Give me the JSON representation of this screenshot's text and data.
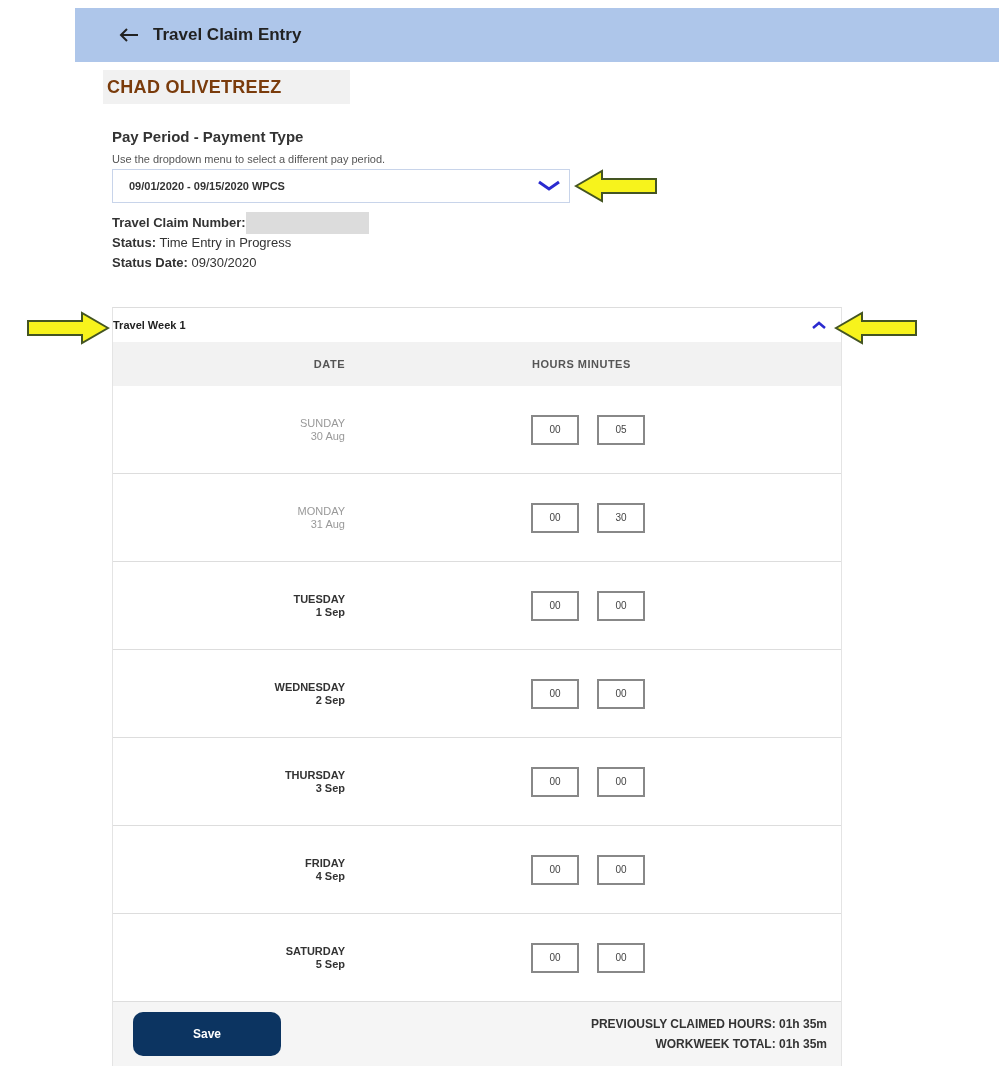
{
  "header": {
    "title": "Travel Claim Entry"
  },
  "employee_name": "CHAD OLIVETREEZ",
  "pay_period": {
    "heading": "Pay Period - Payment Type",
    "hint": "Use the dropdown menu to select a different pay period.",
    "value": "09/01/2020 - 09/15/2020 WPCS",
    "pointer_arrow": true
  },
  "claim": {
    "number_label": "Travel Claim Number:",
    "number_redacted": true,
    "status_label": "Status:",
    "status": "Time Entry in Progress",
    "date_label": "Status Date:",
    "date": "09/30/2020"
  },
  "week": {
    "title": "Travel Week 1",
    "expanded": true,
    "title_pointer_arrow": true,
    "toggle_pointer_arrow": true,
    "columns": [
      "DATE",
      "HOURS MINUTES"
    ],
    "days": [
      {
        "day": "SUNDAY",
        "date": "30 Aug",
        "hours": "00",
        "minutes": "05",
        "disabled": true
      },
      {
        "day": "MONDAY",
        "date": "31 Aug",
        "hours": "00",
        "minutes": "30",
        "disabled": true
      },
      {
        "day": "TUESDAY",
        "date": "1 Sep",
        "hours": "00",
        "minutes": "00",
        "disabled": false
      },
      {
        "day": "WEDNESDAY",
        "date": "2 Sep",
        "hours": "00",
        "minutes": "00",
        "disabled": false
      },
      {
        "day": "THURSDAY",
        "date": "3 Sep",
        "hours": "00",
        "minutes": "00",
        "disabled": false
      },
      {
        "day": "FRIDAY",
        "date": "4 Sep",
        "hours": "00",
        "minutes": "00",
        "disabled": false
      },
      {
        "day": "SATURDAY",
        "date": "5 Sep",
        "hours": "00",
        "minutes": "00",
        "disabled": false
      }
    ]
  },
  "footer": {
    "save": "Save",
    "previously_claimed": "PREVIOUSLY CLAIMED HOURS: 01h 35m",
    "workweek_total": "WORKWEEK TOTAL: 01h 35m"
  }
}
